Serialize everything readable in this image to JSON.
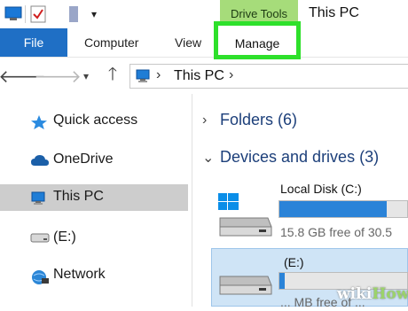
{
  "window": {
    "title": "This PC",
    "context_tab": "Drive Tools",
    "context_color": "#a6dc7a"
  },
  "quick_access": {
    "icons": [
      "computer-icon",
      "properties-icon",
      "new-folder-icon",
      "customize-dropdown-icon"
    ]
  },
  "ribbon": {
    "file_label": "File",
    "file_color": "#1f6fc5",
    "tabs": [
      {
        "label": "Computer"
      },
      {
        "label": "View"
      }
    ],
    "manage_label": "Manage",
    "highlight_color": "#2ee02b"
  },
  "navigation": {
    "back_icon": "back-arrow-icon",
    "forward_icon": "forward-arrow-icon",
    "recent_icon": "chevron-down-icon",
    "up_icon": "up-arrow-icon",
    "address": {
      "location_icon": "computer-icon",
      "location": "This PC"
    }
  },
  "sidebar": {
    "items": [
      {
        "label": "Quick access",
        "icon": "star-icon"
      },
      {
        "label": "OneDrive",
        "icon": "cloud-icon"
      },
      {
        "label": "This PC",
        "icon": "computer-icon",
        "selected": true
      },
      {
        "label": "(E:)",
        "icon": "drive-icon"
      },
      {
        "label": "Network",
        "icon": "network-icon"
      }
    ]
  },
  "content": {
    "folders_section": "Folders (6)",
    "devices_section": "Devices and drives (3)",
    "drives": [
      {
        "label": "Local Disk (C:)",
        "free_text": "15.8 GB free of 30.5",
        "used_fraction": 0.84
      },
      {
        "label": "(E:)",
        "free_text": "... MB free of ...",
        "used_fraction": 0.04
      }
    ]
  },
  "watermark": {
    "prefix": "wiki",
    "suffix": "How"
  }
}
